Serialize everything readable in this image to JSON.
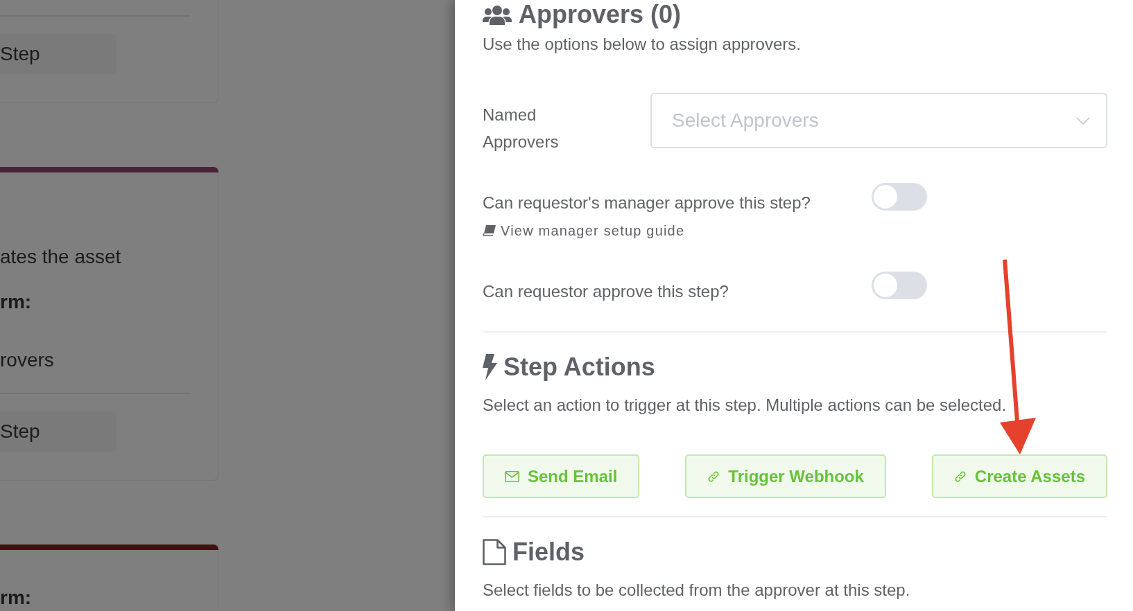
{
  "background_page": {
    "cards": [
      {
        "button": "Step"
      },
      {
        "color": "#4a2238",
        "lines": [
          {
            "text": "ates the asset",
            "kind": "plain"
          },
          {
            "text": "rm:",
            "kind": "bold"
          },
          {
            "text": "rovers",
            "kind": "plain"
          }
        ],
        "button": "Step"
      },
      {
        "color": "#3e1210",
        "lines": [
          {
            "text": "rm:",
            "kind": "bold"
          }
        ]
      }
    ]
  },
  "drawer": {
    "approvers": {
      "title": "Approvers (0)",
      "description": "Use the options below to assign approvers.",
      "named_approvers": {
        "label": "Named Approvers",
        "placeholder": "Select Approvers"
      },
      "toggles": [
        {
          "label": "Can requestor's manager approve this step?",
          "on": false,
          "link": "View manager setup guide"
        },
        {
          "label": "Can requestor approve this step?",
          "on": false
        }
      ]
    },
    "step_actions": {
      "title": "Step Actions",
      "description": "Select an action to trigger at this step. Multiple actions can be selected.",
      "actions": [
        {
          "label": "Send Email",
          "kind": "email"
        },
        {
          "label": "Trigger Webhook",
          "kind": "webhook"
        },
        {
          "label": "Create Assets",
          "kind": "assets"
        }
      ]
    },
    "fields": {
      "title": "Fields",
      "description": "Select fields to be collected from the approver at this step."
    }
  }
}
